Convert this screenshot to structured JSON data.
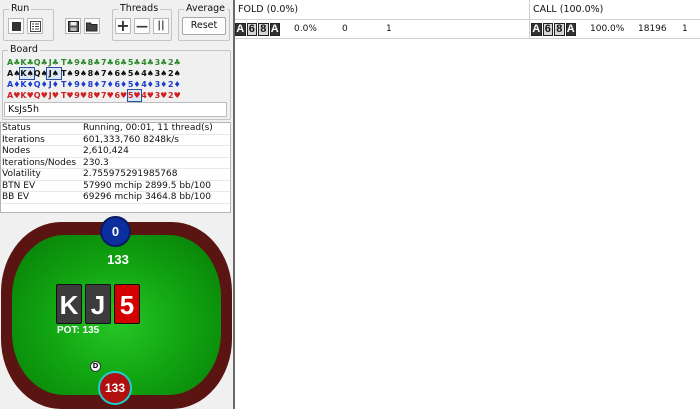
{
  "groups": {
    "run": "Run",
    "threads": "Threads",
    "average": "Average",
    "reset_label": "Reset",
    "board": "Board"
  },
  "icons": {
    "stop": "stop-icon",
    "report": "report-icon",
    "save": "save-icon",
    "open": "folder-icon",
    "plus": "+",
    "minus": "—",
    "pause": "||"
  },
  "card_grid": [
    [
      "A♣",
      "K♣",
      "Q♣",
      "J♣",
      "T♣",
      "9♣",
      "8♣",
      "7♣",
      "6♣",
      "5♣",
      "4♣",
      "3♣",
      "2♣"
    ],
    [
      "A♠",
      "K♠",
      "Q♠",
      "J♠",
      "T♠",
      "9♠",
      "8♠",
      "7♠",
      "6♠",
      "5♠",
      "4♠",
      "3♠",
      "2♠"
    ],
    [
      "A♦",
      "K♦",
      "Q♦",
      "J♦",
      "T♦",
      "9♦",
      "8♦",
      "7♦",
      "6♦",
      "5♦",
      "4♦",
      "3♦",
      "2♦"
    ],
    [
      "A♥",
      "K♥",
      "Q♥",
      "J♥",
      "T♥",
      "9♥",
      "8♥",
      "7♥",
      "6♥",
      "5♥",
      "4♥",
      "3♥",
      "2♥"
    ]
  ],
  "board_text": "KsJs5h",
  "stats": [
    {
      "k": "Status",
      "v": "Running, 00:01, 11 thread(s)"
    },
    {
      "k": "Iterations",
      "v": "601,333,760  8248k/s"
    },
    {
      "k": "Nodes",
      "v": "2,610,424"
    },
    {
      "k": "Iterations/Nodes",
      "v": "230.3"
    },
    {
      "k": "Volatility",
      "v": "2.755975291985768"
    },
    {
      "k": "BTN EV",
      "v": "57990 mchip    2899.5 bb/100"
    },
    {
      "k": "BB EV",
      "v": "69296 mchip    3464.8 bb/100"
    }
  ],
  "table": {
    "top_seat_bet": "0",
    "top_seat_stack": "133",
    "board_cards": [
      {
        "rank": "K",
        "color": "#3c3c3c"
      },
      {
        "rank": "J",
        "color": "#3c3c3c"
      },
      {
        "rank": "5",
        "color": "#d40000"
      }
    ],
    "pot": "POT: 135",
    "dealer": "D",
    "bottom_seat_stack": "133"
  },
  "colors": {
    "divider": "#6a6a6a",
    "felt": "#10a210",
    "rim": "#5a1512"
  },
  "strategy": {
    "fold": {
      "header": "FOLD (0.0%)",
      "hand": [
        "A",
        "6",
        "8",
        "A"
      ],
      "pct": "0.0%",
      "count": "0",
      "combos": "1"
    },
    "call": {
      "header": "CALL (100.0%)",
      "hand": [
        "A",
        "6",
        "8",
        "A"
      ],
      "pct": "100.0%",
      "count": "18196",
      "combos": "1"
    }
  }
}
